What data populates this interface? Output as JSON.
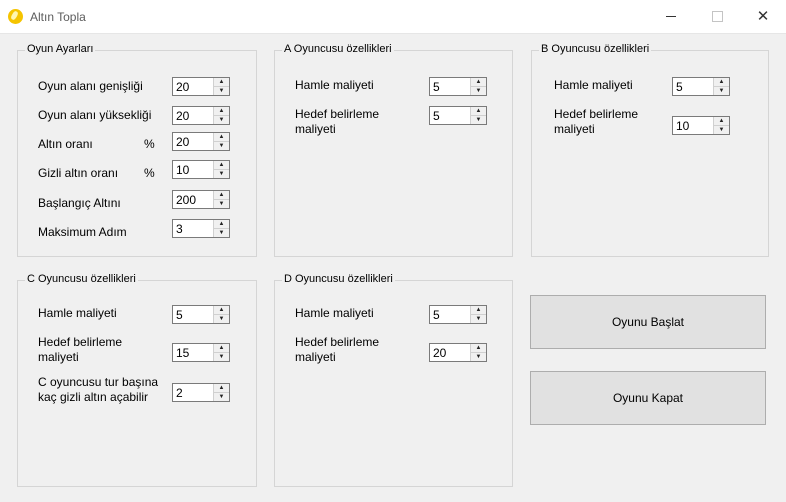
{
  "window": {
    "title": "Altın Topla",
    "icon": "gold-coin-icon"
  },
  "oyun_ayarlari": {
    "title": "Oyun Ayarları",
    "fields": [
      {
        "label": "Oyun alanı genişliği",
        "unit": "",
        "value": "20"
      },
      {
        "label": "Oyun alanı yüksekliği",
        "unit": "",
        "value": "20"
      },
      {
        "label": "Altın oranı",
        "unit": "%",
        "value": "20"
      },
      {
        "label": "Gizli altın oranı",
        "unit": "%",
        "value": "10"
      },
      {
        "label": "Başlangıç Altını",
        "unit": "",
        "value": "200"
      },
      {
        "label": "Maksimum Adım",
        "unit": "",
        "value": "3"
      }
    ]
  },
  "a_oyuncusu": {
    "title": "A Oyuncusu özellikleri",
    "hamle_label": "Hamle maliyeti",
    "hamle_value": "5",
    "hedef_label_1": "Hedef belirleme",
    "hedef_label_2": "maliyeti",
    "hedef_value": "5"
  },
  "b_oyuncusu": {
    "title": "B Oyuncusu özellikleri",
    "hamle_label": "Hamle maliyeti",
    "hamle_value": "5",
    "hedef_label_1": "Hedef belirleme",
    "hedef_label_2": "maliyeti",
    "hedef_value": "10"
  },
  "c_oyuncusu": {
    "title": "C Oyuncusu özellikleri",
    "hamle_label": "Hamle maliyeti",
    "hamle_value": "5",
    "hedef_label_1": "Hedef belirleme",
    "hedef_label_2": "maliyeti",
    "hedef_value": "15",
    "gizli_label_1": "C oyuncusu tur başına",
    "gizli_label_2": "kaç gizli altın açabilir",
    "gizli_value": "2"
  },
  "d_oyuncusu": {
    "title": "D Oyuncusu özellikleri",
    "hamle_label": "Hamle maliyeti",
    "hamle_value": "5",
    "hedef_label_1": "Hedef belirleme",
    "hedef_label_2": "maliyeti",
    "hedef_value": "20"
  },
  "buttons": {
    "start": "Oyunu Başlat",
    "close": "Oyunu Kapat"
  }
}
